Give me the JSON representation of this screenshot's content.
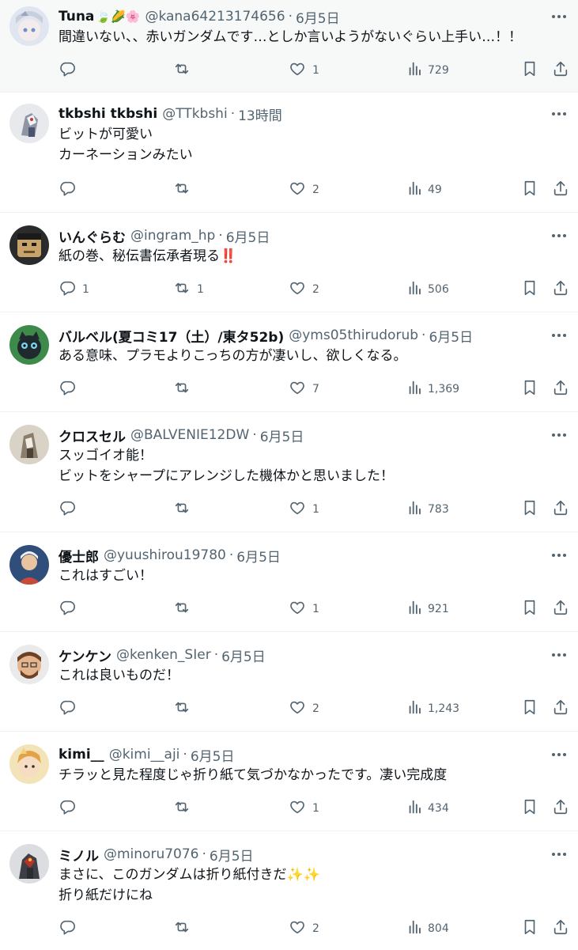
{
  "tweets": [
    {
      "name": "Tuna",
      "name_emoji": "🍃🌽🌸",
      "handle": "@kana64213174656",
      "time": "6月5日",
      "text": "間違いない、、赤いガンダムです…としか言いようがないぐらい上手い…！！",
      "replies": "",
      "retweets": "",
      "likes": "1",
      "views": "729"
    },
    {
      "name": "tkbshi tkbshi",
      "handle": "@TTkbshi",
      "time": "13時間",
      "text": "ビットが可愛い\nカーネーションみたい",
      "replies": "",
      "retweets": "",
      "likes": "2",
      "views": "49"
    },
    {
      "name": "いんぐらむ",
      "handle": "@ingram_hp",
      "time": "6月5日",
      "text": "紙の巻、秘伝書伝承者現る‼️",
      "replies": "1",
      "retweets": "1",
      "likes": "2",
      "views": "506"
    },
    {
      "name": "バルベル(夏コミ17（土）/東タ52b)",
      "handle": "@yms05thirudorub",
      "time": "6月5日",
      "text": "ある意味、プラモよりこっちの方が凄いし、欲しくなる。",
      "replies": "",
      "retweets": "",
      "likes": "7",
      "views": "1,369"
    },
    {
      "name": "クロスセル",
      "handle": "@BALVENIE12DW",
      "time": "6月5日",
      "text": "スッゴイオ能！\nビットをシャープにアレンジした機体かと思いました！",
      "replies": "",
      "retweets": "",
      "likes": "1",
      "views": "783"
    },
    {
      "name": "優士郎",
      "handle": "@yuushirou19780",
      "time": "6月5日",
      "text": "これはすごい！",
      "replies": "",
      "retweets": "",
      "likes": "1",
      "views": "921"
    },
    {
      "name": "ケンケン",
      "handle": "@kenken_SIer",
      "time": "6月5日",
      "text": "これは良いものだ！",
      "replies": "",
      "retweets": "",
      "likes": "2",
      "views": "1,243"
    },
    {
      "name": "kimi__",
      "handle": "@kimi__aji",
      "time": "6月5日",
      "text": "チラッと見た程度じゃ折り紙て気づかなかったです。凄い完成度",
      "replies": "",
      "retweets": "",
      "likes": "1",
      "views": "434"
    },
    {
      "name": "ミノル",
      "handle": "@minoru7076",
      "time": "6月5日",
      "text": "まさに、このガンダムは折り紙付きだ✨✨\n折り紙だけにね",
      "replies": "",
      "retweets": "",
      "likes": "2",
      "views": "804"
    }
  ],
  "icons": {
    "reply": "reply-icon",
    "retweet": "retweet-icon",
    "like": "heart-icon",
    "views": "views-icon",
    "bookmark": "bookmark-icon",
    "share": "share-icon",
    "more": "more-icon"
  },
  "colors": {
    "text": "#0f1419",
    "secondary": "#536471",
    "divider": "#eff3f4",
    "highlight_bg": "#f7f9f9"
  }
}
